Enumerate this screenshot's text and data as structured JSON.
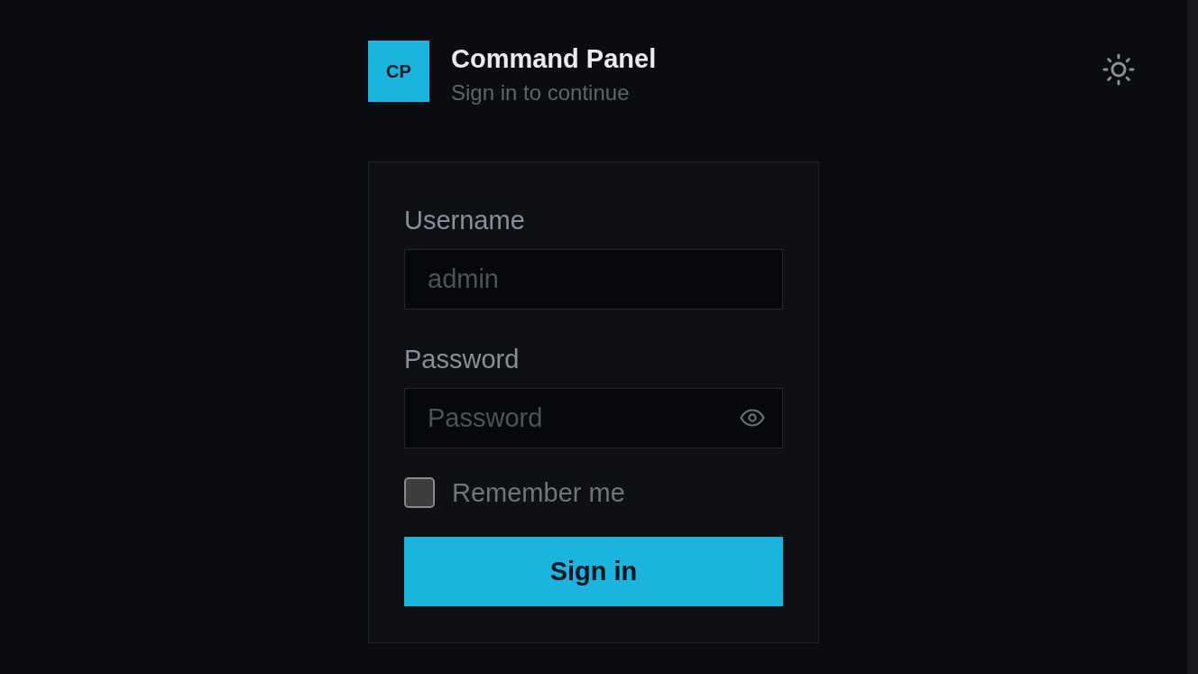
{
  "header": {
    "logo": "CP",
    "title": "Command Panel",
    "subtitle": "Sign in to continue"
  },
  "form": {
    "fields": [
      {
        "kind": "text",
        "label": "Username",
        "placeholder": "admin"
      },
      {
        "kind": "password",
        "label": "Password",
        "placeholder": "Password"
      }
    ],
    "remember": {
      "label": "Remember me",
      "checked": false
    },
    "submit": "Sign in"
  }
}
